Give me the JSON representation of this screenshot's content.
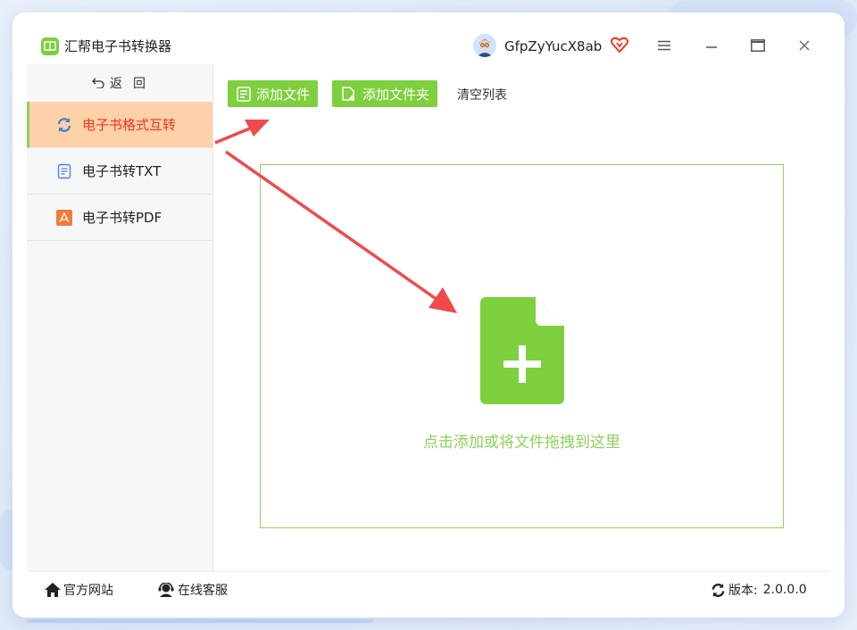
{
  "app": {
    "title": "汇帮电子书转换器"
  },
  "user": {
    "name": "GfpZyYucX8ab"
  },
  "sidebar": {
    "back_label": "返",
    "back_label2": "回",
    "items": [
      {
        "label": "电子书格式互转",
        "icon": "sync-icon",
        "active": true
      },
      {
        "label": "电子书转TXT",
        "icon": "txt-doc-icon",
        "active": false
      },
      {
        "label": "电子书转PDF",
        "icon": "pdf-icon",
        "active": false
      }
    ]
  },
  "toolbar": {
    "add_file": "添加文件",
    "add_folder": "添加文件夹",
    "clear_list": "清空列表"
  },
  "dropzone": {
    "hint": "点击添加或将文件拖拽到这里"
  },
  "footer": {
    "website": "官方网站",
    "support": "在线客服",
    "version_label": "版本:",
    "version_value": "2.0.0.0"
  },
  "colors": {
    "accent_green": "#7ed03e",
    "active_bg": "#ffd1a8",
    "active_text": "#f0381c",
    "annotation_red": "#f04a4a"
  }
}
